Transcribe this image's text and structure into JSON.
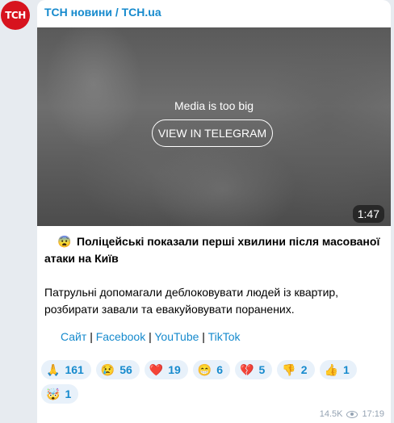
{
  "channel": {
    "avatar_text": "ТСН",
    "name": "ТСН новини / TCH.ua"
  },
  "media": {
    "message": "Media is too big",
    "button_label": "VIEW IN TELEGRAM",
    "duration": "1:47"
  },
  "post": {
    "headline_emoji": "😨",
    "headline": "Поліцейські показали перші хвилини після масованої атаки на Київ",
    "body": "Патрульні допомагали деблоковувати людей із квартир, розбирати завали та евакуйовувати поранених.",
    "links": [
      {
        "label": "Сайт"
      },
      {
        "label": "Facebook"
      },
      {
        "label": "YouTube"
      },
      {
        "label": "TikTok"
      }
    ],
    "link_separator": "|"
  },
  "reactions": [
    {
      "emoji": "🙏",
      "count": "161"
    },
    {
      "emoji": "😢",
      "count": "56"
    },
    {
      "emoji": "❤️",
      "count": "19"
    },
    {
      "emoji": "😁",
      "count": "6"
    },
    {
      "emoji": "💔",
      "count": "5"
    },
    {
      "emoji": "👎",
      "count": "2"
    },
    {
      "emoji": "👍",
      "count": "1"
    },
    {
      "emoji": "🤯",
      "count": "1"
    }
  ],
  "meta": {
    "views": "14.5K",
    "time": "17:19",
    "views_icon": "eye-icon"
  },
  "colors": {
    "accent": "#168acd",
    "avatar_bg": "#d7131e",
    "background": "#e7ebf0"
  }
}
